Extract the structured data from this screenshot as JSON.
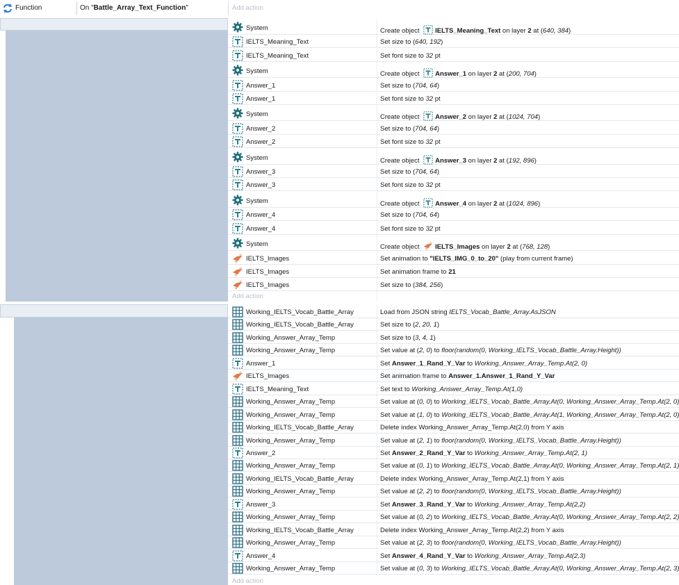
{
  "header": {
    "label": "Function",
    "name": "On \"Battle_Array_Text_Function\"",
    "add_action": "Add action"
  },
  "block1": {
    "add_action": "Add action",
    "rows": [
      {
        "icon": "gear",
        "obj": "System",
        "act": [
          [
            "",
            "Create object "
          ],
          [
            "icon",
            "text"
          ],
          [
            "b",
            "IELTS_Meaning_Text"
          ],
          [
            "",
            " on layer "
          ],
          [
            "b",
            "2"
          ],
          [
            "",
            " at ("
          ],
          [
            "i",
            "640, 384"
          ],
          [
            "",
            ")"
          ]
        ]
      },
      {
        "icon": "text",
        "obj": "IELTS_Meaning_Text",
        "act": [
          [
            "",
            "Set size to ("
          ],
          [
            "i",
            "640, 192"
          ],
          [
            "",
            ")"
          ]
        ]
      },
      {
        "icon": "text",
        "obj": "IELTS_Meaning_Text",
        "act": [
          [
            "",
            "Set font size to "
          ],
          [
            "i",
            "32"
          ],
          [
            "",
            " pt"
          ]
        ]
      },
      {
        "icon": "gear",
        "obj": "System",
        "act": [
          [
            "",
            "Create object "
          ],
          [
            "icon",
            "text"
          ],
          [
            "b",
            "Answer_1"
          ],
          [
            "",
            " on layer "
          ],
          [
            "b",
            "2"
          ],
          [
            "",
            " at ("
          ],
          [
            "i",
            "200, 704"
          ],
          [
            "",
            ")"
          ]
        ]
      },
      {
        "icon": "text",
        "obj": "Answer_1",
        "act": [
          [
            "",
            "Set size to ("
          ],
          [
            "i",
            "704, 64"
          ],
          [
            "",
            ")"
          ]
        ]
      },
      {
        "icon": "text",
        "obj": "Answer_1",
        "act": [
          [
            "",
            "Set font size to "
          ],
          [
            "i",
            "32"
          ],
          [
            "",
            " pt"
          ]
        ]
      },
      {
        "icon": "gear",
        "obj": "System",
        "act": [
          [
            "",
            "Create object "
          ],
          [
            "icon",
            "text"
          ],
          [
            "b",
            "Answer_2"
          ],
          [
            "",
            " on layer "
          ],
          [
            "b",
            "2"
          ],
          [
            "",
            " at ("
          ],
          [
            "i",
            "1024, 704"
          ],
          [
            "",
            ")"
          ]
        ]
      },
      {
        "icon": "text",
        "obj": "Answer_2",
        "act": [
          [
            "",
            "Set size to ("
          ],
          [
            "i",
            "704, 64"
          ],
          [
            "",
            ")"
          ]
        ]
      },
      {
        "icon": "text",
        "obj": "Answer_2",
        "act": [
          [
            "",
            "Set font size to "
          ],
          [
            "i",
            "32"
          ],
          [
            "",
            " pt"
          ]
        ]
      },
      {
        "icon": "gear",
        "obj": "System",
        "act": [
          [
            "",
            "Create object "
          ],
          [
            "icon",
            "text"
          ],
          [
            "b",
            "Answer_3"
          ],
          [
            "",
            " on layer "
          ],
          [
            "b",
            "2"
          ],
          [
            "",
            " at ("
          ],
          [
            "i",
            "192, 896"
          ],
          [
            "",
            ")"
          ]
        ]
      },
      {
        "icon": "text",
        "obj": "Answer_3",
        "act": [
          [
            "",
            "Set size to ("
          ],
          [
            "i",
            "704, 64"
          ],
          [
            "",
            ")"
          ]
        ]
      },
      {
        "icon": "text",
        "obj": "Answer_3",
        "act": [
          [
            "",
            "Set font size to "
          ],
          [
            "i",
            "32"
          ],
          [
            "",
            " pt"
          ]
        ]
      },
      {
        "icon": "gear",
        "obj": "System",
        "act": [
          [
            "",
            "Create object "
          ],
          [
            "icon",
            "text"
          ],
          [
            "b",
            "Answer_4"
          ],
          [
            "",
            " on layer "
          ],
          [
            "b",
            "2"
          ],
          [
            "",
            " at ("
          ],
          [
            "i",
            "1024, 896"
          ],
          [
            "",
            ")"
          ]
        ]
      },
      {
        "icon": "text",
        "obj": "Answer_4",
        "act": [
          [
            "",
            "Set size to ("
          ],
          [
            "i",
            "704, 64"
          ],
          [
            "",
            ")"
          ]
        ]
      },
      {
        "icon": "text",
        "obj": "Answer_4",
        "act": [
          [
            "",
            "Set font size to "
          ],
          [
            "i",
            "32"
          ],
          [
            "",
            " pt"
          ]
        ]
      },
      {
        "icon": "gear",
        "obj": "System",
        "act": [
          [
            "",
            "Create object "
          ],
          [
            "icon",
            "sprite"
          ],
          [
            "b",
            "IELTS_Images"
          ],
          [
            "",
            " on layer "
          ],
          [
            "b",
            "2"
          ],
          [
            "",
            " at ("
          ],
          [
            "i",
            "768, 128"
          ],
          [
            "",
            ")"
          ]
        ]
      },
      {
        "icon": "sprite",
        "obj": "IELTS_Images",
        "act": [
          [
            "",
            "Set animation to "
          ],
          [
            "b",
            "\"IELTS_IMG_0_to_20\""
          ],
          [
            "",
            " (play from current frame)"
          ]
        ]
      },
      {
        "icon": "sprite",
        "obj": "IELTS_Images",
        "act": [
          [
            "",
            "Set animation frame to "
          ],
          [
            "b",
            "21"
          ]
        ]
      },
      {
        "icon": "sprite",
        "obj": "IELTS_Images",
        "act": [
          [
            "",
            "Set size to ("
          ],
          [
            "i",
            "384, 256"
          ],
          [
            "",
            ")"
          ]
        ]
      }
    ]
  },
  "block2": {
    "add_action": "Add action",
    "rows": [
      {
        "icon": "array",
        "obj": "Working_IELTS_Vocab_Battle_Array",
        "act": [
          [
            "",
            "Load from JSON string "
          ],
          [
            "i",
            "IELTS_Vocab_Battle_Array.AsJSON"
          ]
        ]
      },
      {
        "icon": "array",
        "obj": "Working_IELTS_Vocab_Battle_Array",
        "act": [
          [
            "",
            "Set size to ("
          ],
          [
            "i",
            "2, 20, 1"
          ],
          [
            "",
            ")"
          ]
        ]
      },
      {
        "icon": "array",
        "obj": "Working_Answer_Array_Temp",
        "act": [
          [
            "",
            "Set size to ("
          ],
          [
            "i",
            "3, 4, 1"
          ],
          [
            "",
            ")"
          ]
        ]
      },
      {
        "icon": "array",
        "obj": "Working_Answer_Array_Temp",
        "act": [
          [
            "",
            "Set value at ("
          ],
          [
            "i",
            "2, 0"
          ],
          [
            "",
            ") to "
          ],
          [
            "i",
            "floor(random(0, Working_IELTS_Vocab_Battle_Array.Height))"
          ]
        ]
      },
      {
        "icon": "text",
        "obj": "Answer_1",
        "act": [
          [
            "",
            "Set "
          ],
          [
            "b",
            "Answer_1_Rand_Y_Var"
          ],
          [
            "",
            " to "
          ],
          [
            "i",
            "Working_Answer_Array_Temp.At(2, 0)"
          ]
        ]
      },
      {
        "icon": "sprite",
        "obj": "IELTS_Images",
        "act": [
          [
            "",
            "Set animation frame to "
          ],
          [
            "b",
            "Answer_1.Answer_1_Rand_Y_Var"
          ]
        ]
      },
      {
        "icon": "text",
        "obj": "IELTS_Meaning_Text",
        "act": [
          [
            "",
            "Set text to "
          ],
          [
            "i",
            "Working_Answer_Array_Temp.At(1,0)"
          ]
        ]
      },
      {
        "icon": "array",
        "obj": "Working_Answer_Array_Temp",
        "act": [
          [
            "",
            "Set value at ("
          ],
          [
            "i",
            "0, 0"
          ],
          [
            "",
            ") to "
          ],
          [
            "i",
            "Working_IELTS_Vocab_Battle_Array.At(0, Working_Answer_Array_Temp.At(2, 0))"
          ]
        ]
      },
      {
        "icon": "array",
        "obj": "Working_Answer_Array_Temp",
        "act": [
          [
            "",
            "Set value at ("
          ],
          [
            "i",
            "1, 0"
          ],
          [
            "",
            ") to "
          ],
          [
            "i",
            "Working_IELTS_Vocab_Battle_Array.At(1, Working_Answer_Array_Temp.At(2, 0))"
          ]
        ]
      },
      {
        "icon": "array",
        "obj": "Working_IELTS_Vocab_Battle_Array",
        "act": [
          [
            "",
            "Delete index Working_Answer_Array_Temp.At(2,0) from Y axis"
          ]
        ]
      },
      {
        "icon": "array",
        "obj": "Working_Answer_Array_Temp",
        "act": [
          [
            "",
            "Set value at ("
          ],
          [
            "i",
            "2, 1"
          ],
          [
            "",
            ") to "
          ],
          [
            "i",
            "floor(random(0, Working_IELTS_Vocab_Battle_Array.Height))"
          ]
        ]
      },
      {
        "icon": "text",
        "obj": "Answer_2",
        "act": [
          [
            "",
            "Set "
          ],
          [
            "b",
            "Answer_2_Rand_Y_Var"
          ],
          [
            "",
            " to "
          ],
          [
            "i",
            "Working_Answer_Array_Temp.At(2, 1)"
          ]
        ]
      },
      {
        "icon": "array",
        "obj": "Working_Answer_Array_Temp",
        "act": [
          [
            "",
            "Set value at ("
          ],
          [
            "i",
            "0, 1"
          ],
          [
            "",
            ") to "
          ],
          [
            "i",
            "Working_IELTS_Vocab_Battle_Array.At(0, Working_Answer_Array_Temp.At(2, 1))"
          ]
        ]
      },
      {
        "icon": "array",
        "obj": "Working_IELTS_Vocab_Battle_Array",
        "act": [
          [
            "",
            "Delete index Working_Answer_Array_Temp.At(2,1) from Y axis"
          ]
        ]
      },
      {
        "icon": "array",
        "obj": "Working_Answer_Array_Temp",
        "act": [
          [
            "",
            "Set value at ("
          ],
          [
            "i",
            "2, 2"
          ],
          [
            "",
            ") to "
          ],
          [
            "i",
            "floor(random(0, Working_IELTS_Vocab_Battle_Array.Height))"
          ]
        ]
      },
      {
        "icon": "text",
        "obj": "Answer_3",
        "act": [
          [
            "",
            "Set "
          ],
          [
            "b",
            "Answer_3_Rand_Y_Var"
          ],
          [
            "",
            " to "
          ],
          [
            "i",
            "Working_Answer_Array_Temp.At(2,2)"
          ]
        ]
      },
      {
        "icon": "array",
        "obj": "Working_Answer_Array_Temp",
        "act": [
          [
            "",
            "Set value at ("
          ],
          [
            "i",
            "0, 2"
          ],
          [
            "",
            ") to "
          ],
          [
            "i",
            "Working_IELTS_Vocab_Battle_Array.At(0, Working_Answer_Array_Temp.At(2, 2))"
          ]
        ]
      },
      {
        "icon": "array",
        "obj": "Working_IELTS_Vocab_Battle_Array",
        "act": [
          [
            "",
            "Delete index Working_Answer_Array_Temp.At(2,2) from Y axis"
          ]
        ]
      },
      {
        "icon": "array",
        "obj": "Working_Answer_Array_Temp",
        "act": [
          [
            "",
            "Set value at ("
          ],
          [
            "i",
            "2, 3"
          ],
          [
            "",
            ") to "
          ],
          [
            "i",
            "floor(random(0, Working_IELTS_Vocab_Battle_Array.Height))"
          ]
        ]
      },
      {
        "icon": "text",
        "obj": "Answer_4",
        "act": [
          [
            "",
            "Set "
          ],
          [
            "b",
            "Answer_4_Rand_Y_Var"
          ],
          [
            "",
            " to "
          ],
          [
            "i",
            "Working_Answer_Array_Temp.At(2,3)"
          ]
        ]
      },
      {
        "icon": "array",
        "obj": "Working_Answer_Array_Temp",
        "act": [
          [
            "",
            "Set value at ("
          ],
          [
            "i",
            "0, 3"
          ],
          [
            "",
            ") to "
          ],
          [
            "i",
            "Working_IELTS_Vocab_Battle_Array.At(0, Working_Answer_Array_Temp.At(2, 3))"
          ]
        ]
      }
    ]
  },
  "icons": {
    "gear": "gear-icon",
    "text": "text-object-icon",
    "sprite": "sprite-object-icon",
    "array": "array-object-icon"
  },
  "colors": {
    "block_left": "#bccadb",
    "block_head": "#e9eef4",
    "gear": "#1f6f7a",
    "text_icon": "#2f7f8a",
    "array_icon": "#2f6f85",
    "sprite_icon": "#e07a4a",
    "add_action": "#b8bfc8"
  }
}
